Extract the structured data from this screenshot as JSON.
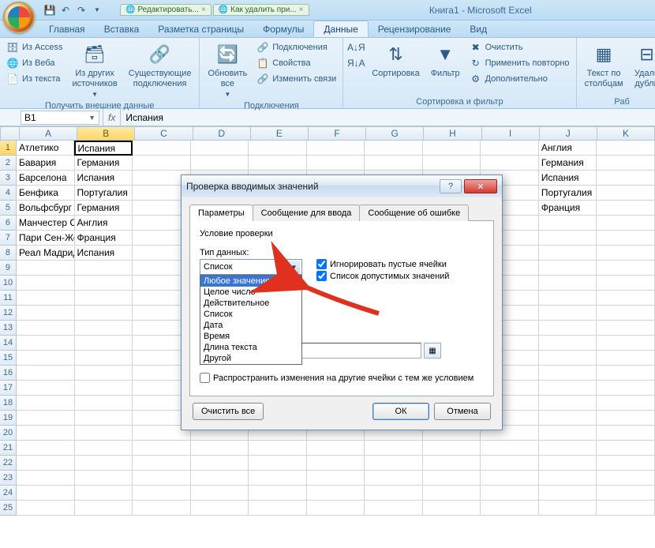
{
  "app": {
    "title": "Книга1 - Microsoft Excel"
  },
  "qat": {
    "save": "💾",
    "undo": "↶",
    "redo": "↷"
  },
  "browser_tabs": [
    {
      "label": "Редактировать..."
    },
    {
      "label": "Как удалить при..."
    }
  ],
  "tabs": {
    "home": "Главная",
    "insert": "Вставка",
    "layout": "Разметка страницы",
    "formulas": "Формулы",
    "data": "Данные",
    "review": "Рецензирование",
    "view": "Вид"
  },
  "ribbon": {
    "ext_data": {
      "access": "Из Access",
      "web": "Из Веба",
      "text": "Из текста",
      "other": "Из других источников",
      "existing": "Существующие подключения",
      "group": "Получить внешние данные"
    },
    "connections": {
      "refresh": "Обновить все",
      "conns": "Подключения",
      "props": "Свойства",
      "links": "Изменить связи",
      "group": "Подключения"
    },
    "sortfilter": {
      "az": "А↓Я",
      "za": "Я↓А",
      "sort": "Сортировка",
      "filter": "Фильтр",
      "clear": "Очистить",
      "reapply": "Применить повторно",
      "advanced": "Дополнительно",
      "group": "Сортировка и фильтр"
    },
    "datatools": {
      "t2c": "Текст по столбцам",
      "remdup": "Удали дубли",
      "group": "Раб"
    }
  },
  "formula": {
    "namebox": "B1",
    "fx": "fx",
    "value": "Испания"
  },
  "columns": [
    "A",
    "B",
    "C",
    "D",
    "E",
    "F",
    "G",
    "H",
    "I",
    "J",
    "K"
  ],
  "rows_count": 25,
  "cells": {
    "A": [
      "Атлетико",
      "Бавария",
      "Барселона",
      "Бенфика",
      "Вольфсбург",
      "Манчестер Сити",
      "Пари Сен-Жермен",
      "Реал Мадрид"
    ],
    "B": [
      "Испания",
      "Германия",
      "Испания",
      "Португалия",
      "Германия",
      "Англия",
      "Франция",
      "Испания"
    ],
    "J": [
      "Англия",
      "Германия",
      "Испания",
      "Португалия",
      "Франция"
    ]
  },
  "active_cell_col": 1,
  "dialog": {
    "title": "Проверка вводимых значений",
    "tabs": {
      "params": "Параметры",
      "input_msg": "Сообщение для ввода",
      "error_msg": "Сообщение об ошибке"
    },
    "cond_label": "Условие проверки",
    "type_label": "Тип данных:",
    "type_value": "Список",
    "type_options": [
      "Любое значение",
      "Целое число",
      "Действительное",
      "Список",
      "Дата",
      "Время",
      "Длина текста",
      "Другой"
    ],
    "type_selected_index": 0,
    "chk_ignore": "Игнорировать пустые ячейки",
    "chk_list": "Список допустимых значений",
    "propagate": "Распространить изменения на другие ячейки с тем же условием",
    "clear": "Очистить все",
    "ok": "ОК",
    "cancel": "Отмена"
  }
}
